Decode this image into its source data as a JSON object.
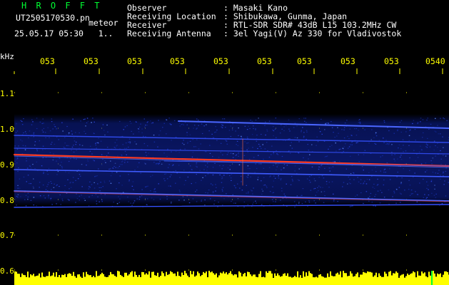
{
  "header": {
    "brand": "H R O F F T",
    "filename": "UT2505170530.pn",
    "mode": "meteor",
    "datetime": "25.05.17 05:30   1.."
  },
  "info": [
    {
      "label": "Observer",
      "value": ": Masaki Kano"
    },
    {
      "label": "Receiving Location",
      "value": ": Shibukawa, Gunma, Japan"
    },
    {
      "label": "Receiver",
      "value": ": RTL-SDR SDR# 43dB L15 103.2MHz CW"
    },
    {
      "label": "Receiving Antenna",
      "value": ": 3el Yagi(V) Az 330 for Vladivostok"
    }
  ],
  "axes": {
    "y_unit": "kHz",
    "y_ticks": [
      "1.1",
      "1.0",
      "0.9",
      "0.8",
      "0.7",
      "0.6"
    ],
    "x_ticks": [
      "053",
      "053",
      "053",
      "053",
      "053",
      "053",
      "053",
      "053",
      "053",
      "0540"
    ]
  },
  "colors": {
    "background": "#000000",
    "brand": "#00ff33",
    "labels": "#ffffff",
    "ticks": "#ffff00",
    "noise": "#1428c8",
    "signal": "#ff2a1a"
  }
}
